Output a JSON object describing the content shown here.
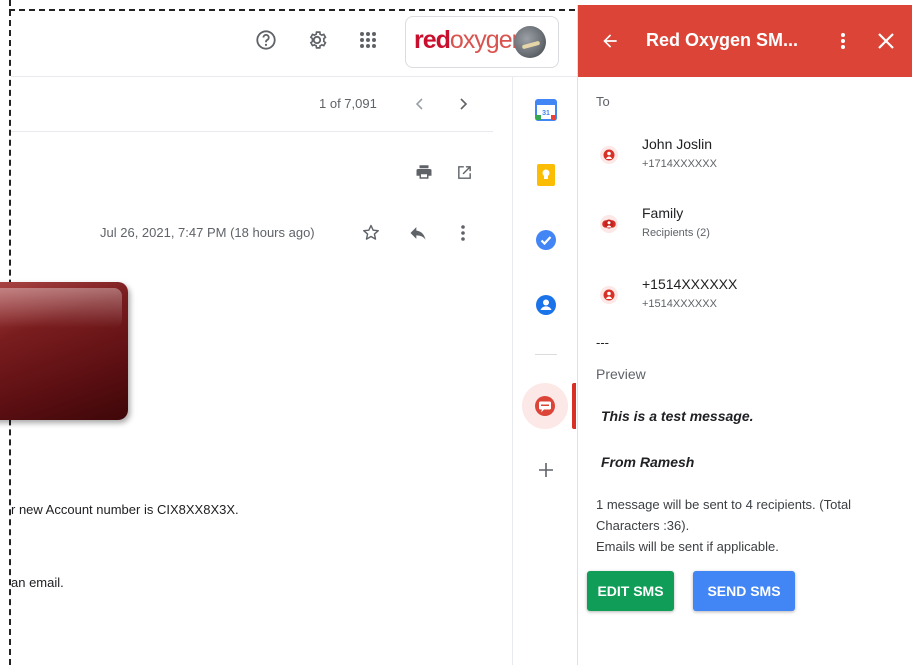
{
  "brand": {
    "logo_text_red": "red",
    "logo_text_rest": "oxygen"
  },
  "email": {
    "pager": "1 of 7,091",
    "date": "Jul 26, 2021, 7:47 PM (18 hours ago)",
    "body_line_1": "r new Account number is CI",
    "body_line_1_masked": "X8XX8X3X",
    "body_line_2": "an email."
  },
  "panel": {
    "title": "Red Oxygen SM...",
    "to_label": "To",
    "recipients": [
      {
        "name": "John Joslin",
        "sub": "+1714XXXXXX",
        "icon": "person-icon"
      },
      {
        "name": "Family",
        "sub": "Recipients (2)",
        "icon": "group-icon"
      },
      {
        "name": "+1514XXXXXX",
        "sub": "+1514XXXXXX",
        "icon": "person-icon"
      }
    ],
    "separator": "---",
    "preview_label": "Preview",
    "preview_message": "This is a test message.",
    "preview_from": "From Ramesh",
    "summary_line": "1  message will be sent to 4  recipients. (Total Characters :36).",
    "summary_emails": "Emails will be sent if applicable.",
    "edit_button": "EDIT SMS",
    "send_button": "SEND SMS"
  },
  "colors": {
    "panel_header": "#db4437",
    "edit_button": "#0f9d58",
    "send_button": "#4285f4"
  }
}
